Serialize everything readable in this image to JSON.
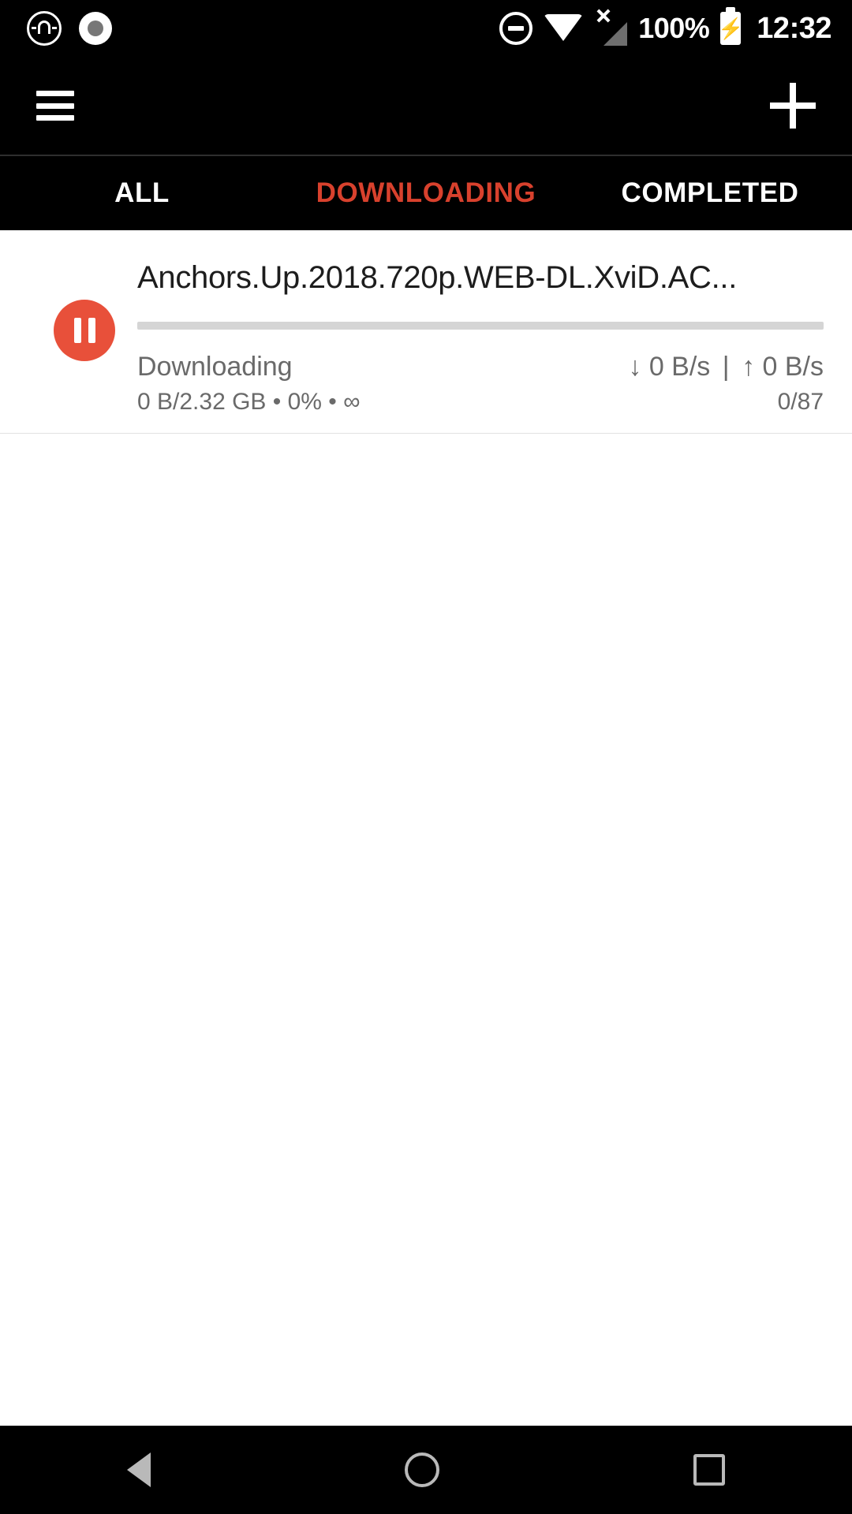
{
  "statusbar": {
    "left_icons": [
      "magnet-circle-icon",
      "screen-record-icon"
    ],
    "dnd_icon": "do-not-disturb-icon",
    "wifi_icon": "wifi-full-icon",
    "signal_icon": "no-sim-signal-icon",
    "battery_percent": "100%",
    "battery_icon": "battery-charging-icon",
    "time": "12:32"
  },
  "appbar": {
    "menu_icon": "hamburger-menu-icon",
    "add_icon": "plus-add-icon"
  },
  "tabs": [
    {
      "label": "ALL",
      "active": false
    },
    {
      "label": "DOWNLOADING",
      "active": true
    },
    {
      "label": "COMPLETED",
      "active": false
    }
  ],
  "colors": {
    "accent": "#d8412d",
    "pause_button": "#e8503a",
    "bar_background": "#000000",
    "progress_track": "#d5d5d5",
    "secondary_text": "#6a6a6a"
  },
  "downloads": [
    {
      "title": "Anchors.Up.2018.720p.WEB-DL.XviD.AC...",
      "action_icon": "pause-icon",
      "progress_percent": 0,
      "status": "Downloading",
      "size_line": "0 B/2.32 GB • 0% • ∞",
      "download_arrow": "↓",
      "download_speed": "0 B/s",
      "separator": "|",
      "upload_arrow": "↑",
      "upload_speed": "0 B/s",
      "peers": "0/87"
    }
  ],
  "navbar": {
    "back": "back-nav-icon",
    "home": "home-nav-icon",
    "recents": "recents-nav-icon"
  }
}
